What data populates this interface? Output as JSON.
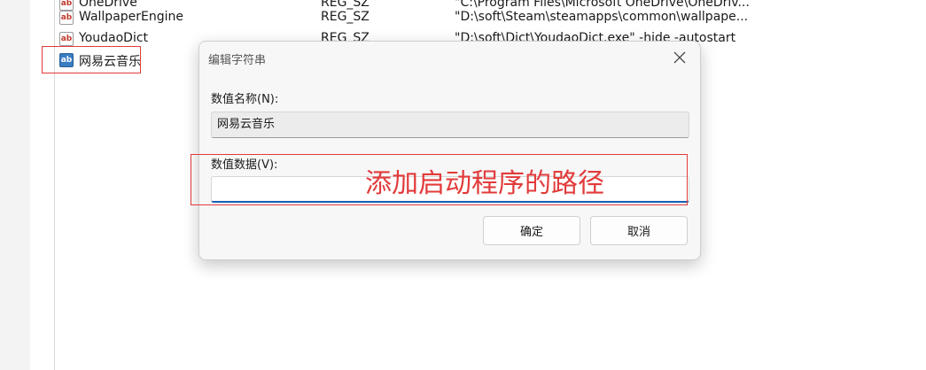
{
  "registry": {
    "rows": [
      {
        "icon": "ab",
        "name": "OneDrive",
        "type": "REG_SZ",
        "data": "\"C:\\Program Files\\Microsoft OneDrive\\OneDriv..."
      },
      {
        "icon": "ab",
        "name": "WallpaperEngine",
        "type": "REG_SZ",
        "data": "\"D:\\soft\\Steam\\steamapps\\common\\wallpape..."
      },
      {
        "icon": "ab",
        "name": "YoudaoDict",
        "type": "REG_SZ",
        "data": "\"D:\\soft\\Dict\\YoudaoDict.exe\" -hide -autostart"
      },
      {
        "icon": "ab",
        "name": "网易云音乐",
        "type": "",
        "data": ""
      }
    ]
  },
  "dialog": {
    "title": "编辑字符串",
    "close_glyph": "✕",
    "value_name_label": "数值名称(N):",
    "value_name": "网易云音乐",
    "value_data_label": "数值数据(V):",
    "value_data": "",
    "ok_label": "确定",
    "cancel_label": "取消"
  },
  "annotation": {
    "text": "添加启动程序的路径",
    "color": "#e23b3b"
  }
}
